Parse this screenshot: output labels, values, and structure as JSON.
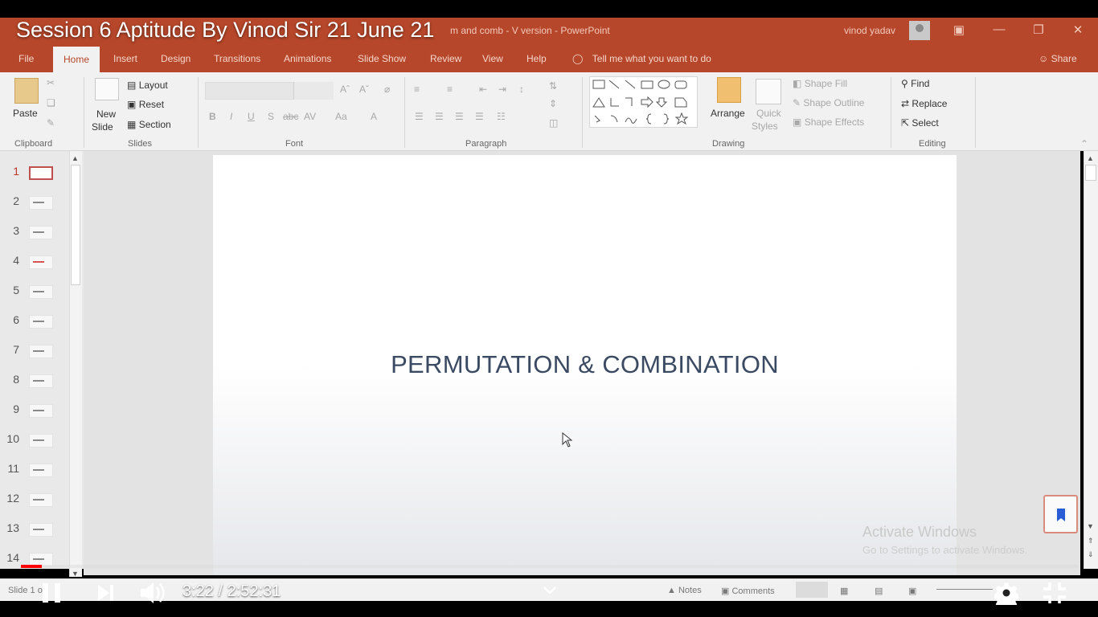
{
  "video": {
    "title": "Session 6 Aptitude By Vinod Sir 21 June 21",
    "current_time": "3:22",
    "duration": "2:52:31",
    "time_display": "3:22 / 2:52:31",
    "progress": 0.0195,
    "buffered": 0.02,
    "accent_color": "#ff0000"
  },
  "powerpoint": {
    "doc_title": "m and comb - V version  -  PowerPoint",
    "user": "vinod yadav",
    "tabs": [
      "File",
      "Home",
      "Insert",
      "Design",
      "Transitions",
      "Animations",
      "Slide Show",
      "Review",
      "View",
      "Help"
    ],
    "active_tab": "Home",
    "tell_me": "Tell me what you want to do",
    "share": "Share",
    "ribbon": {
      "clipboard": {
        "label": "Clipboard",
        "paste": "Paste"
      },
      "slides": {
        "label": "Slides",
        "new_slide": "New",
        "new_slide_2": "Slide",
        "layout": "Layout",
        "reset": "Reset",
        "section": "Section"
      },
      "font": {
        "label": "Font"
      },
      "paragraph": {
        "label": "Paragraph"
      },
      "drawing": {
        "label": "Drawing",
        "arrange": "Arrange",
        "quick_styles": "Quick",
        "quick_styles_2": "Styles",
        "shape_fill": "Shape Fill",
        "shape_outline": "Shape Outline",
        "shape_effects": "Shape Effects"
      },
      "editing": {
        "label": "Editing",
        "find": "Find",
        "replace": "Replace",
        "select": "Select"
      }
    },
    "slide_numbers": [
      "1",
      "2",
      "3",
      "4",
      "5",
      "6",
      "7",
      "8",
      "9",
      "10",
      "11",
      "12",
      "13",
      "14"
    ],
    "active_slide": "1",
    "slide_title": "PERMUTATION & COMBINATION",
    "status": {
      "slide_info": "Slide 1 o",
      "notes": "Notes",
      "comments": "Comments"
    },
    "watermark": {
      "line1": "Activate Windows",
      "line2": "Go to Settings to activate Windows."
    },
    "brand_color": "#b7472a"
  }
}
